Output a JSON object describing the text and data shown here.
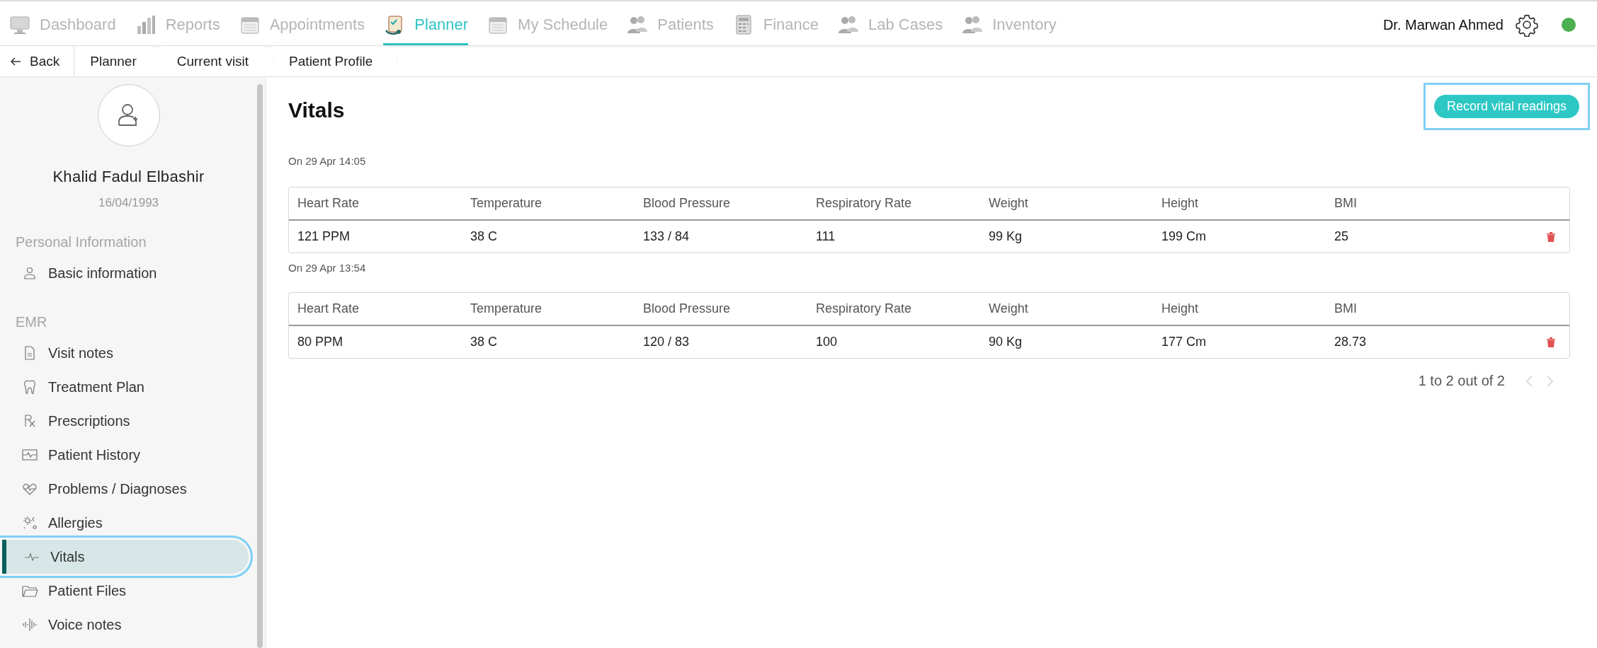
{
  "nav": {
    "items": [
      {
        "label": "Dashboard",
        "kind": "monitor",
        "selected": false
      },
      {
        "label": "Reports",
        "kind": "chart",
        "selected": false
      },
      {
        "label": "Appointments",
        "kind": "calendar",
        "selected": false
      },
      {
        "label": "Planner",
        "kind": "clipboard",
        "selected": true
      },
      {
        "label": "My Schedule",
        "kind": "calendar",
        "selected": false
      },
      {
        "label": "Patients",
        "kind": "people",
        "selected": false
      },
      {
        "label": "Finance",
        "kind": "calculator",
        "selected": false
      },
      {
        "label": "Lab Cases",
        "kind": "people",
        "selected": false
      },
      {
        "label": "Inventory",
        "kind": "people",
        "selected": false
      }
    ],
    "user": "Dr. Marwan Ahmed",
    "online": true
  },
  "breadcrumb": {
    "back": "Back",
    "items": [
      "Planner",
      "Current visit",
      "Patient Profile"
    ]
  },
  "sidebar": {
    "patient_name": "Khalid Fadul Elbashir",
    "birth_date": "16/04/1993",
    "sections": [
      {
        "title": "Personal Information",
        "items": [
          {
            "label": "Basic information",
            "kind": "person",
            "selected": false
          }
        ]
      },
      {
        "title": "EMR",
        "items": [
          {
            "label": "Visit notes",
            "kind": "document",
            "selected": false
          },
          {
            "label": "Treatment Plan",
            "kind": "tooth",
            "selected": false
          },
          {
            "label": "Prescriptions",
            "kind": "rx",
            "selected": false
          },
          {
            "label": "Patient History",
            "kind": "monitor-pulse",
            "selected": false
          },
          {
            "label": "Problems / Diagnoses",
            "kind": "heart-pulse",
            "selected": false
          },
          {
            "label": "Allergies",
            "kind": "allergy",
            "selected": false
          },
          {
            "label": "Vitals",
            "kind": "pulse",
            "selected": true
          },
          {
            "label": "Patient Files",
            "kind": "folder",
            "selected": false
          },
          {
            "label": "Voice notes",
            "kind": "waveform",
            "selected": false
          }
        ]
      }
    ]
  },
  "main": {
    "title": "Vitals",
    "record_button": {
      "label": "Record vital readings",
      "focused": true
    },
    "readings": [
      {
        "date": "On 29 Apr 14:05",
        "columns": [
          "Heart Rate",
          "Temperature",
          "Blood Pressure",
          "Respiratory Rate",
          "Weight",
          "Height",
          "BMI"
        ],
        "values": [
          "121 PPM",
          "38 C",
          "133 / 84",
          "111",
          "99 Kg",
          "199 Cm",
          "25"
        ]
      },
      {
        "date": "On 29 Apr 13:54",
        "columns": [
          "Heart Rate",
          "Temperature",
          "Blood Pressure",
          "Respiratory Rate",
          "Weight",
          "Height",
          "BMI"
        ],
        "values": [
          "80 PPM",
          "38 C",
          "120 / 83",
          "100",
          "90 Kg",
          "177 Cm",
          "28.73"
        ]
      }
    ],
    "pagination": {
      "text": "1 to 2 out of 2",
      "prev_disabled": true,
      "next_disabled": true
    }
  }
}
